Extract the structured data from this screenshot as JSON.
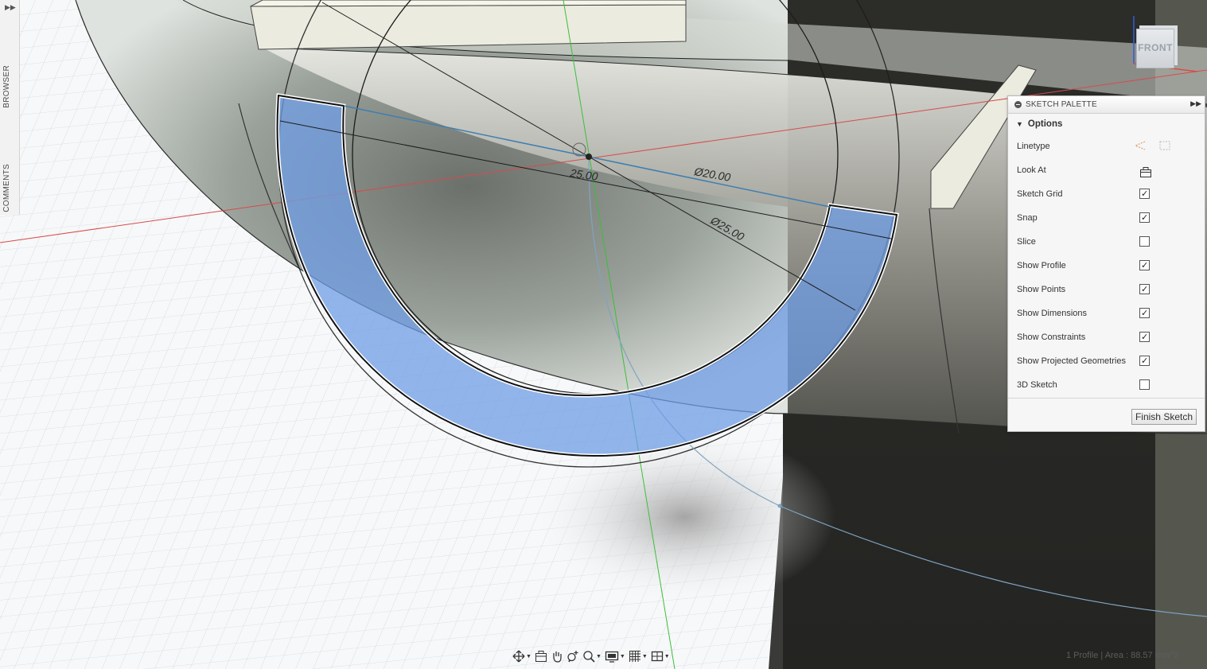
{
  "left_rail": {
    "expand_icon": "double-chevron-right-icon",
    "browser_label": "BROWSER",
    "comments_label": "COMMENTS"
  },
  "viewcube": {
    "face_label": "FRONT"
  },
  "sketch": {
    "dimensions": {
      "horizontal": "25.00",
      "inner_diameter": "Ø20.00",
      "outer_diameter": "Ø25.00"
    },
    "profile_color": "#6f9ee6"
  },
  "palette": {
    "title": "SKETCH PALETTE",
    "section": "Options",
    "rows": [
      {
        "label": "Linetype",
        "control": "icons"
      },
      {
        "label": "Look At",
        "control": "icon"
      },
      {
        "label": "Sketch Grid",
        "checked": true
      },
      {
        "label": "Snap",
        "checked": true
      },
      {
        "label": "Slice",
        "checked": false
      },
      {
        "label": "Show Profile",
        "checked": true
      },
      {
        "label": "Show Points",
        "checked": true
      },
      {
        "label": "Show Dimensions",
        "checked": true
      },
      {
        "label": "Show Constraints",
        "checked": true
      },
      {
        "label": "Show Projected Geometries",
        "checked": true
      },
      {
        "label": "3D Sketch",
        "checked": false
      }
    ],
    "finish_label": "Finish Sketch"
  },
  "navbar": {
    "tools": [
      "orbit-icon",
      "look-at-icon",
      "pan-hand-icon",
      "zoom-icon",
      "fit-zoom-icon",
      "display-settings-icon",
      "grid-settings-icon",
      "viewports-icon"
    ]
  },
  "status": {
    "text": "1 Profile | Area : 88.57 mm^2"
  }
}
